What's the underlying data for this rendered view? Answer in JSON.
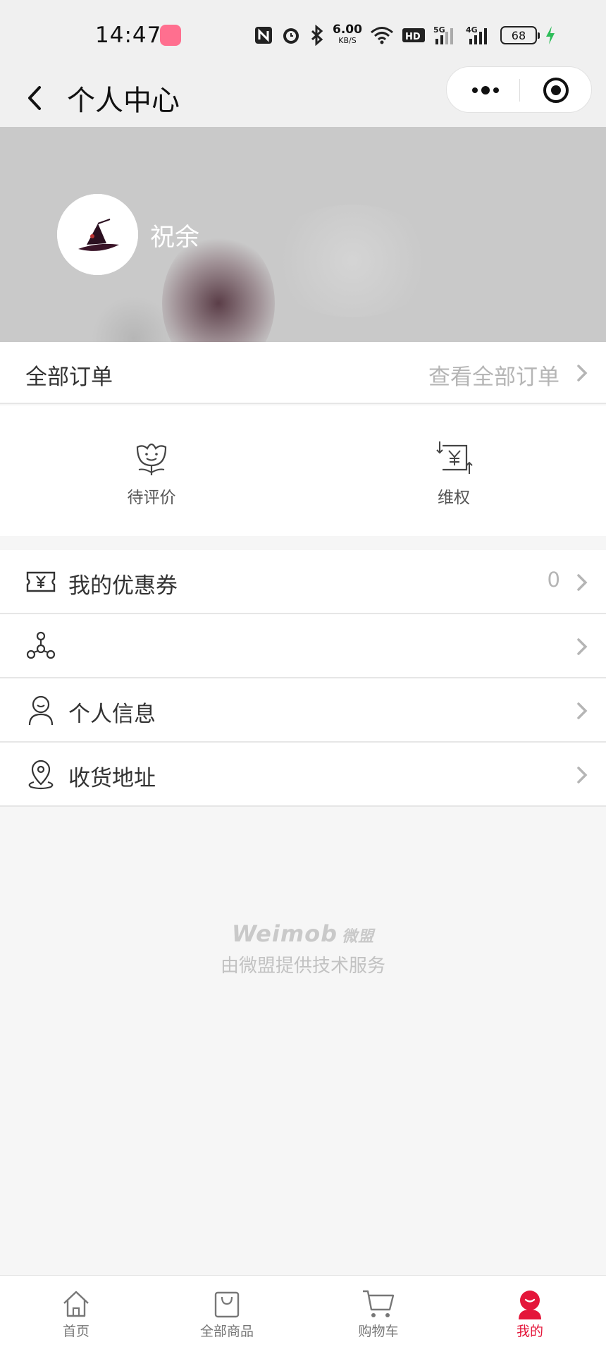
{
  "status_bar": {
    "time": "14:47",
    "net_speed": "6.00",
    "net_unit": "KB/S",
    "battery": "68",
    "hd_label": "HD",
    "sig1_label": "5G",
    "sig2_label": "4G"
  },
  "nav": {
    "title": "个人中心"
  },
  "profile": {
    "user_name": "祝余"
  },
  "orders": {
    "title": "全部订单",
    "view_all": "查看全部订单",
    "items": [
      {
        "label": "待评价",
        "icon": "flower-smile-icon"
      },
      {
        "label": "维权",
        "icon": "yuan-exchange-icon"
      }
    ]
  },
  "menu": {
    "coupons": {
      "label": "我的优惠券",
      "value": "0",
      "icon": "coupon-icon"
    },
    "distribution": {
      "label": "",
      "icon": "network-nodes-icon"
    },
    "personal_info": {
      "label": "个人信息",
      "icon": "person-icon"
    },
    "address": {
      "label": "收货地址",
      "icon": "location-pin-icon"
    }
  },
  "footer": {
    "brand": "Weimob",
    "brand_cn": "微盟",
    "service_text": "由微盟提供技术服务"
  },
  "tabs": [
    {
      "label": "首页",
      "icon": "home-icon"
    },
    {
      "label": "全部商品",
      "icon": "shopping-bag-icon"
    },
    {
      "label": "购物车",
      "icon": "cart-icon"
    },
    {
      "label": "我的",
      "icon": "user-face-icon",
      "active": true
    }
  ],
  "colors": {
    "accent": "#e4163a",
    "banner": "#c9c9c9",
    "page_bg": "#f6f6f6"
  }
}
